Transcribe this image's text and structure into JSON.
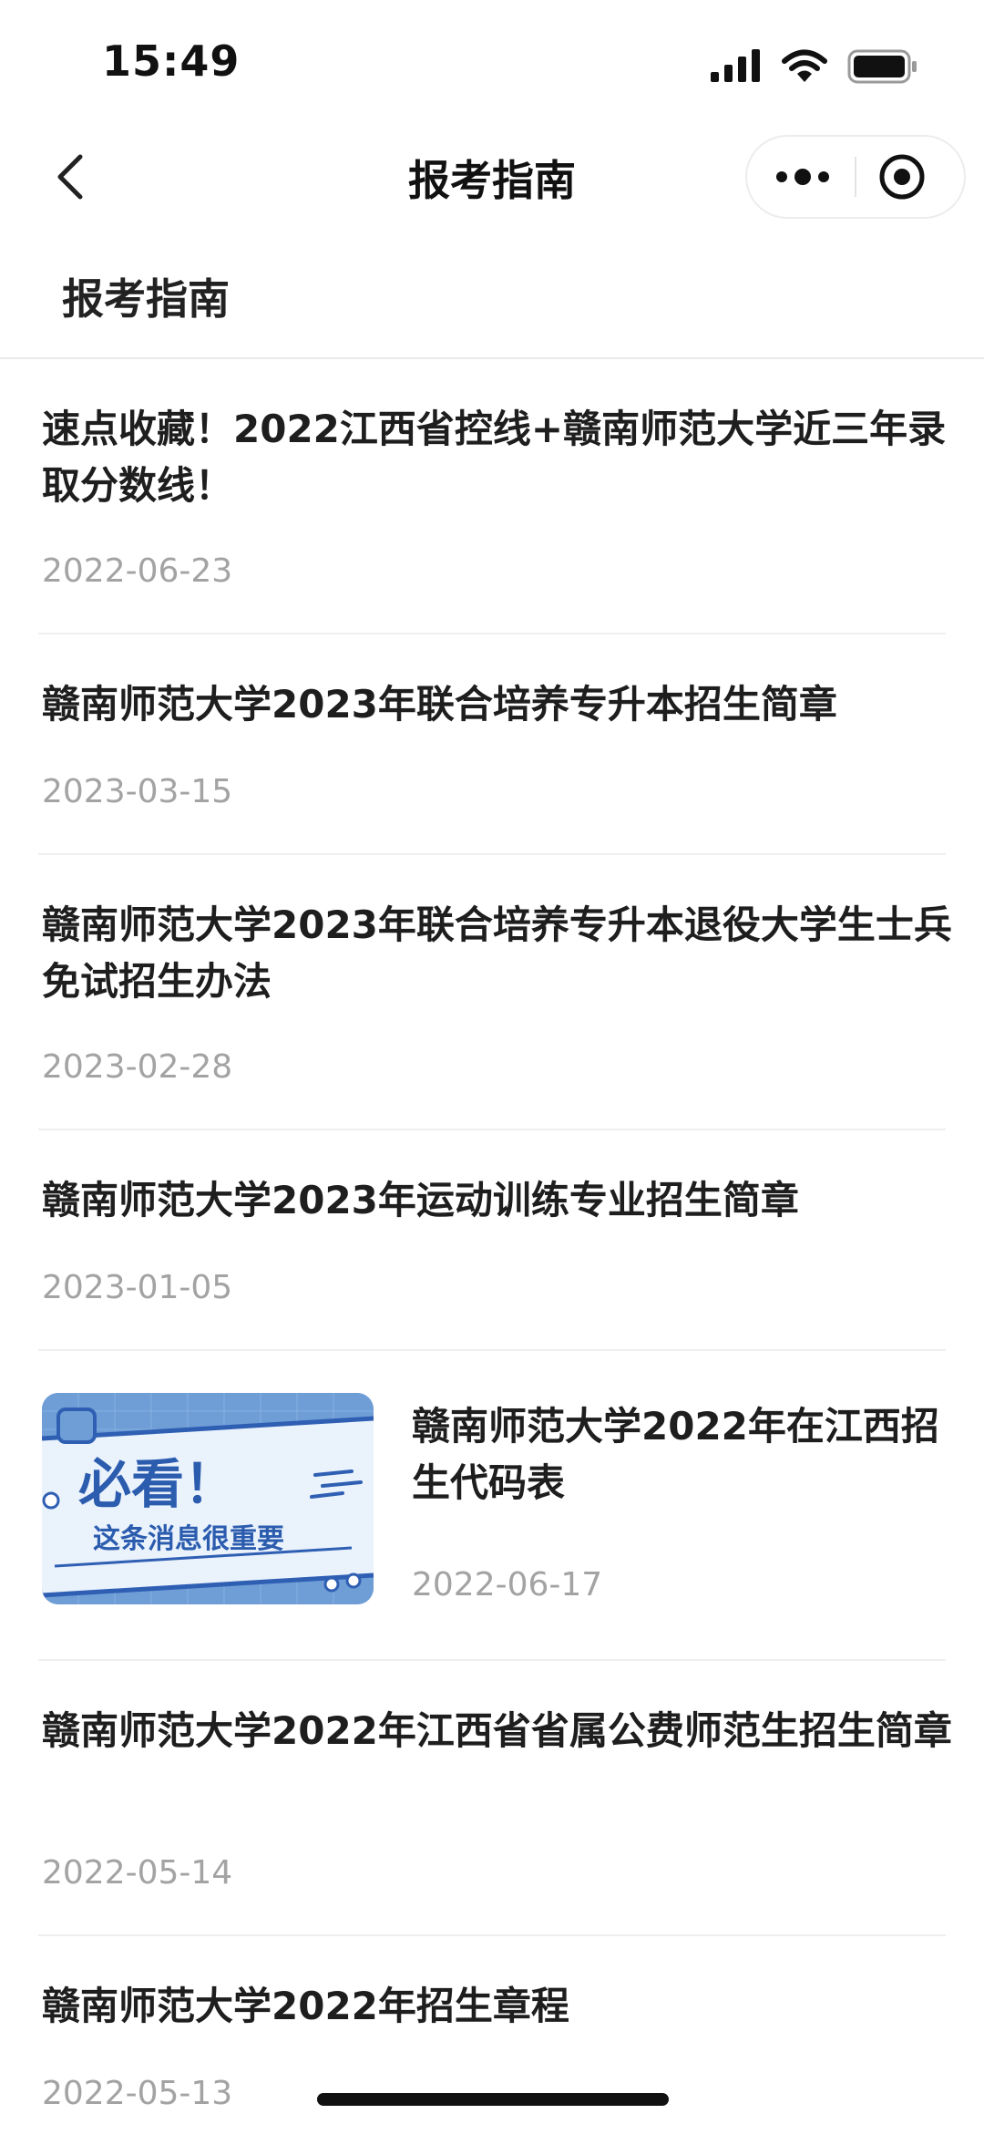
{
  "status_bar": {
    "time": "15:49"
  },
  "nav": {
    "title": "报考指南"
  },
  "section": {
    "title": "报考指南"
  },
  "thumbnail": {
    "headline": "必看！",
    "subline": "这条消息很重要"
  },
  "articles": [
    {
      "title": "速点收藏！2022江西省控线+赣南师范大学近三年录取分数线！",
      "date": "2022-06-23"
    },
    {
      "title": "赣南师范大学2023年联合培养专升本招生简章",
      "date": "2023-03-15"
    },
    {
      "title": "赣南师范大学2023年联合培养专升本退役大学生士兵免试招生办法",
      "date": "2023-02-28"
    },
    {
      "title": "赣南师范大学2023年运动训练专业招生简章",
      "date": "2023-01-05"
    },
    {
      "title": "赣南师范大学2022年在江西招生代码表",
      "date": "2022-06-17"
    },
    {
      "title": "赣南师范大学2022年江西省省属公费师范生招生简章",
      "date": "2022-05-14"
    },
    {
      "title": "赣南师范大学2022年招生章程",
      "date": "2022-05-13"
    }
  ]
}
